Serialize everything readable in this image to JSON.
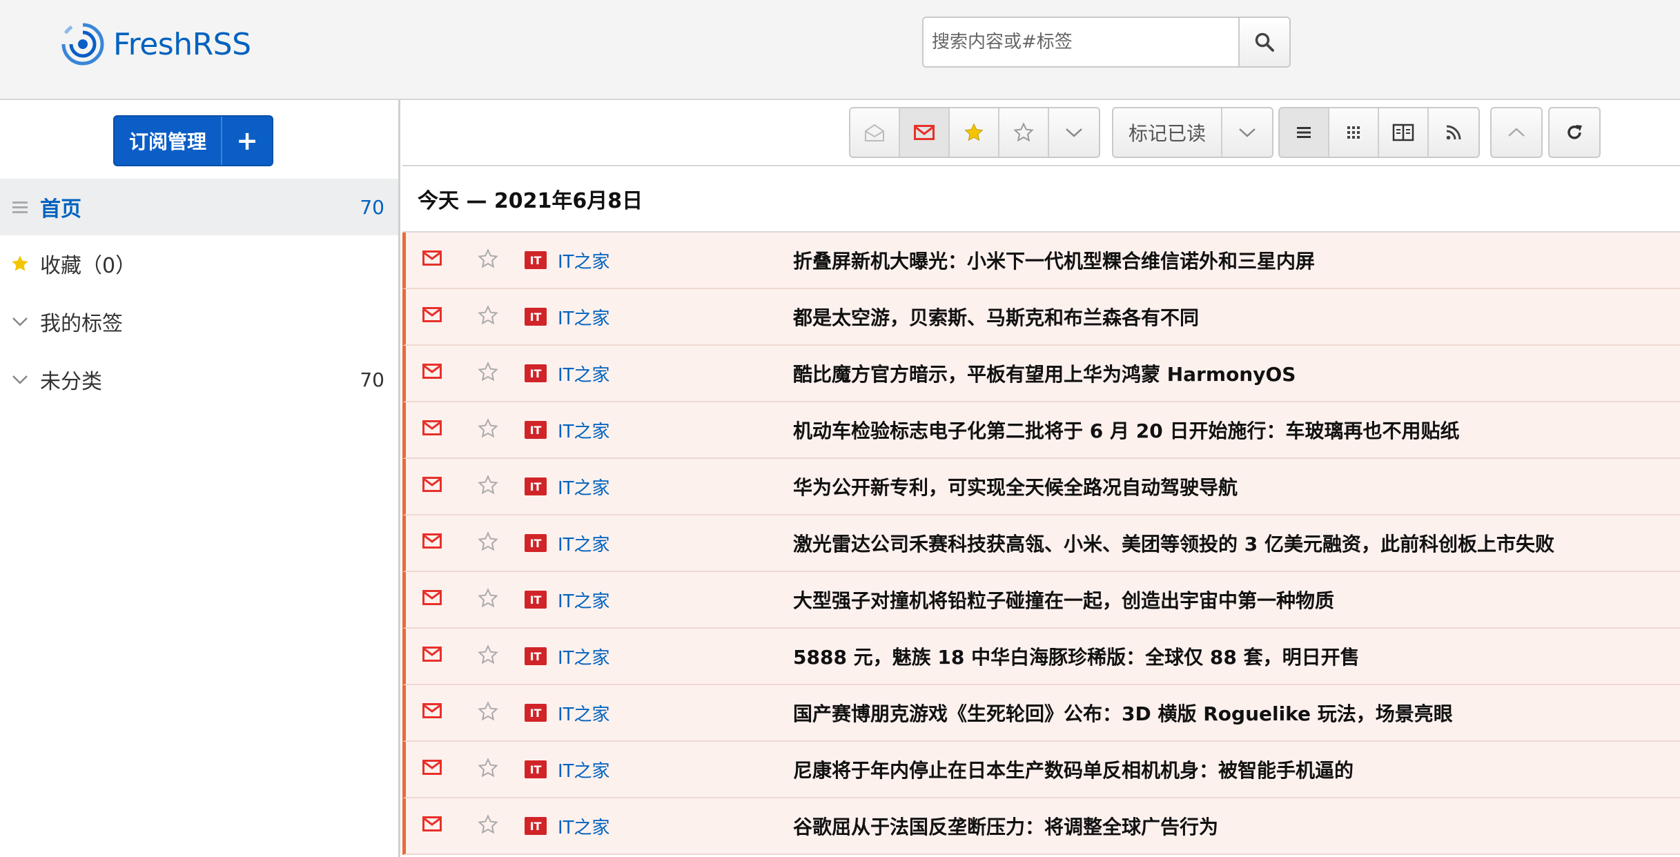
{
  "app": {
    "name": "FreshRSS"
  },
  "search": {
    "placeholder": "搜索内容或#标签"
  },
  "sidebar": {
    "subscribe_label": "订阅管理",
    "add_label": "+",
    "items": [
      {
        "label": "首页",
        "count": "70"
      },
      {
        "label": "收藏（0）",
        "count": ""
      },
      {
        "label": "我的标签",
        "count": ""
      },
      {
        "label": "未分类",
        "count": "70"
      }
    ]
  },
  "toolbar": {
    "mark_read_label": "标记已读"
  },
  "main": {
    "date_heading": "今天 — 2021年6月8日",
    "feed_icon_text": "IT",
    "articles": [
      {
        "feed": "IT之家",
        "title": "折叠屏新机大曝光：小米下一代机型粿合维信诺外和三星内屏"
      },
      {
        "feed": "IT之家",
        "title": "都是太空游，贝索斯、马斯克和布兰森各有不同"
      },
      {
        "feed": "IT之家",
        "title": "酷比魔方官方暗示，平板有望用上华为鸿蒙 HarmonyOS"
      },
      {
        "feed": "IT之家",
        "title": "机动车检验标志电子化第二批将于 6 月 20 日开始施行：车玻璃再也不用贴纸"
      },
      {
        "feed": "IT之家",
        "title": "华为公开新专利，可实现全天候全路况自动驾驶导航"
      },
      {
        "feed": "IT之家",
        "title": "激光雷达公司禾赛科技获高瓴、小米、美团等领投的 3 亿美元融资，此前科创板上市失败"
      },
      {
        "feed": "IT之家",
        "title": "大型强子对撞机将铅粒子碰撞在一起，创造出宇宙中第一种物质"
      },
      {
        "feed": "IT之家",
        "title": "5888 元，魅族 18 中华白海豚珍稀版：全球仅 88 套，明日开售"
      },
      {
        "feed": "IT之家",
        "title": "国产赛博朋克游戏《生死轮回》公布：3D 横版 Roguelike 玩法，场景亮眼"
      },
      {
        "feed": "IT之家",
        "title": "尼康将于年内停止在日本生产数码单反相机机身：被智能手机逼的"
      },
      {
        "feed": "IT之家",
        "title": "谷歌屈从于法国反垄断压力：将调整全球广告行为"
      }
    ]
  },
  "colors": {
    "accent": "#0062be",
    "unread": "#e8302a",
    "star": "#f5c400",
    "row_bg": "#fdf1ee"
  }
}
